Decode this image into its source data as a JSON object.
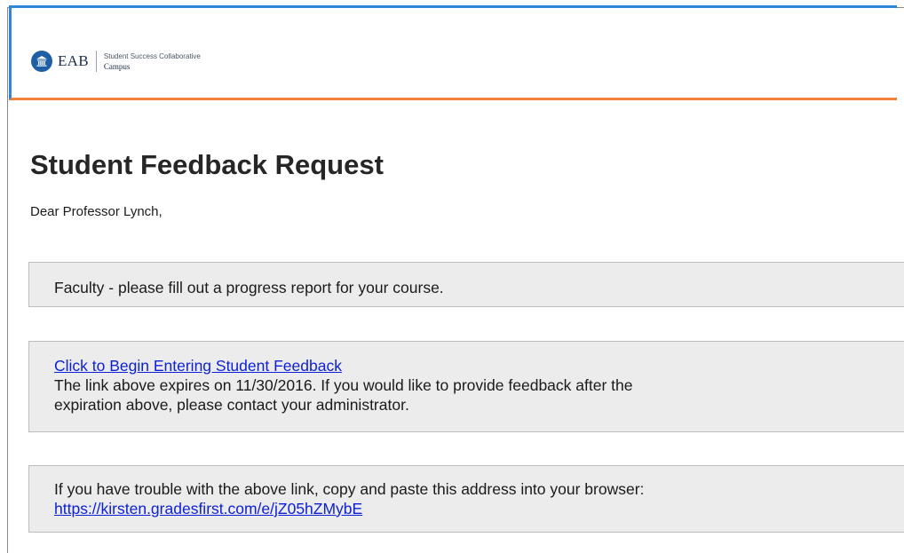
{
  "header": {
    "logo_text": "EAB",
    "logo_subtitle": "Student Success Collaborative",
    "logo_subtitle_2": "Campus"
  },
  "title": "Student Feedback Request",
  "greeting": "Dear Professor Lynch,",
  "notice": {
    "text": "Faculty - please fill out a progress report for your course."
  },
  "feedback": {
    "link_label": "Click to Begin Entering Student Feedback",
    "expiry_line_1": "The link above expires on 11/30/2016. If you would like to provide feedback after the",
    "expiry_line_2": "expiration above, please contact your administrator."
  },
  "fallback": {
    "text": "If you have trouble with the above link, copy and paste this address into your browser:",
    "url": "https://kirsten.gradesfirst.com/e/jZ05hZMybE"
  },
  "colors": {
    "header_blue": "#2f86d6",
    "header_orange": "#f0823c",
    "link": "#0b1fd6",
    "box_bg": "#ececec"
  }
}
